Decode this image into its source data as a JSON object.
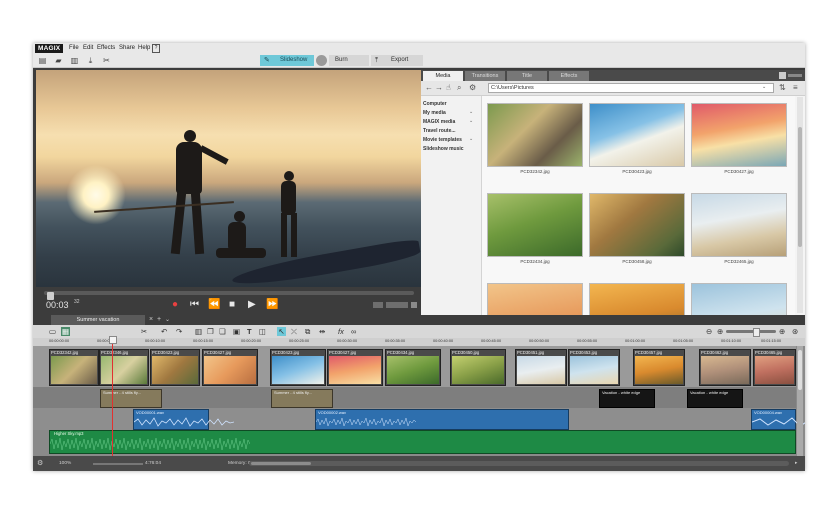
{
  "app": {
    "logo": "MAGIX",
    "menu": [
      "File",
      "Edit",
      "Effects",
      "Share",
      "Help"
    ]
  },
  "modes": {
    "slideshow": "Slideshow",
    "burn": "Burn",
    "export": "Export"
  },
  "preview": {
    "timecode": "00:03",
    "timecode_unit": "32"
  },
  "pool": {
    "tabs": [
      "Media",
      "Transitions",
      "Title",
      "Effects"
    ],
    "path": "C:\\Users\\Pictures",
    "folders": [
      {
        "label": "Computer",
        "arrow": ""
      },
      {
        "label": "My media",
        "arrow": "⌄"
      },
      {
        "label": "MAGIX media",
        "arrow": "⌄"
      },
      {
        "label": "Travel route...",
        "arrow": ""
      },
      {
        "label": "Movie templates",
        "arrow": "⌄"
      },
      {
        "label": "Slideshow music",
        "arrow": ""
      }
    ],
    "thumbnails": [
      {
        "caption": "PCD32342.jpg"
      },
      {
        "caption": "PCD30423.jpg"
      },
      {
        "caption": "PCD30427.jpg"
      },
      {
        "caption": "PCD32434.jpg"
      },
      {
        "caption": "PCD30458.jpg"
      },
      {
        "caption": "PCD32465.jpg"
      },
      {
        "caption": ""
      },
      {
        "caption": ""
      },
      {
        "caption": ""
      }
    ]
  },
  "timeline": {
    "project_tab": "Summer vacation",
    "ruler": [
      "00:00:00:00",
      "00:00:05:00",
      "00:00:10:00",
      "00:00:15:00",
      "00:00:20:00",
      "00:00:25:00",
      "00:00:30:00",
      "00:00:35:00",
      "00:00:40:00",
      "00:00:45:00",
      "00:00:50:00",
      "00:00:55:00",
      "00:01:00:00",
      "00:01:05:00",
      "00:01:10:00",
      "00:01:15:00"
    ],
    "clips": [
      {
        "label": "PCD32342.jpg"
      },
      {
        "label": "PCD32346.jpg"
      },
      {
        "label": "PCD30423.jpg"
      },
      {
        "label": "PCD30427.jpg"
      },
      {
        "label": "PCD30423.jpg"
      },
      {
        "label": "PCD30427.jpg"
      },
      {
        "label": "PCD30434.jpg"
      },
      {
        "label": "PCD30450.jpg"
      },
      {
        "label": "PCD30451.jpg"
      },
      {
        "label": "PCD30453.jpg"
      },
      {
        "label": "PCD30457.jpg"
      },
      {
        "label": "PCD30462.jpg"
      },
      {
        "label": "PCD30465.jpg"
      }
    ],
    "transitions": [
      {
        "label": "Summer - 4 stills fly..."
      },
      {
        "label": "Summer - 4 stills fly..."
      },
      {
        "label": "Vacation - white edge"
      },
      {
        "label": "Vacation - white edge"
      }
    ],
    "voice_clips": [
      {
        "label": "VOD00001.wav"
      },
      {
        "label": "VOD00002.wav"
      },
      {
        "label": "VOD00004.wav"
      }
    ],
    "music_label": "Higher Sky.mp3"
  },
  "status": {
    "zoom": "100%",
    "duration": "4:76:04",
    "memory": "Memory: 0"
  },
  "colors": {
    "accent": "#6ec8d8",
    "music": "#1e8a45",
    "voice": "#2e6fae",
    "playhead": "#e23030"
  }
}
